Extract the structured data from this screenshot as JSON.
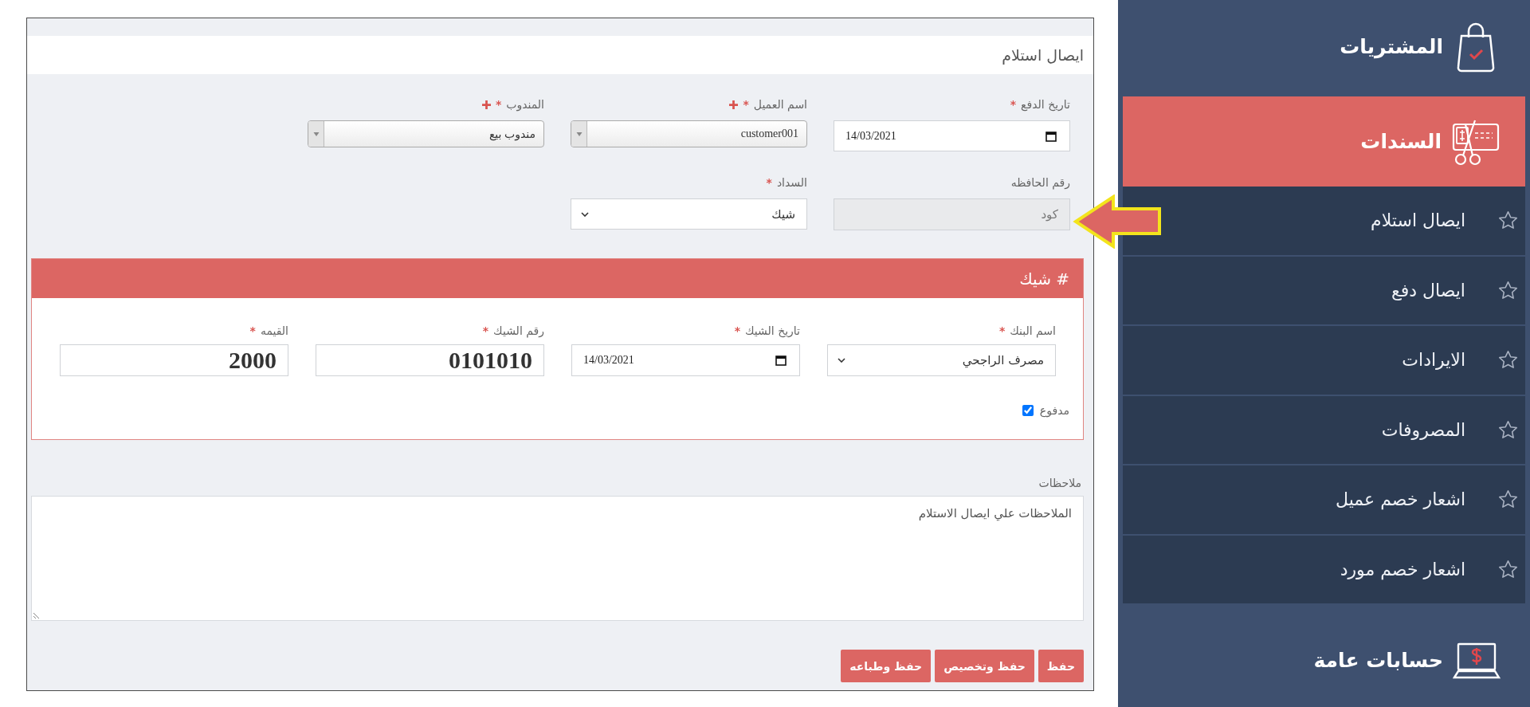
{
  "form": {
    "title": "ايصال استلام",
    "fields": [
      {
        "kind": "date",
        "label": "تاريخ الدفع",
        "mark": "*",
        "addable": false,
        "disabled": false,
        "value": "14/03/2021"
      },
      {
        "kind": "combo",
        "label": "اسم العميل",
        "mark": "*",
        "addable": true,
        "disabled": false,
        "value": "customer001"
      },
      {
        "kind": "combo",
        "label": "المندوب",
        "mark": "*",
        "addable": true,
        "disabled": false,
        "value": "مندوب بيع"
      },
      {
        "kind": "text",
        "label": "رقم الحافظه",
        "addable": false,
        "disabled": true,
        "placeholder": "كود"
      },
      {
        "kind": "select",
        "label": "السداد",
        "mark": "*",
        "addable": false,
        "disabled": false,
        "value": "شيك"
      }
    ]
  },
  "cheque": {
    "title": "# شيك",
    "fields": [
      {
        "kind": "select",
        "label": "اسم البنك",
        "mark": "*",
        "value": "مصرف الراجحي"
      },
      {
        "kind": "date",
        "label": "تاريخ الشيك",
        "mark": "*",
        "value": "14/03/2021"
      },
      {
        "kind": "number",
        "label": "رقم الشيك",
        "mark": "*",
        "value": "0101010"
      },
      {
        "kind": "number",
        "label": "القيمه",
        "mark": "*",
        "value": "2000"
      }
    ],
    "paid": {
      "label": "مدفوع",
      "checked": true
    }
  },
  "notes": {
    "label": "ملاحظات",
    "value": "الملاحظات علي ايصال الاستلام"
  },
  "buttons": [
    "حفظ",
    "حفظ وتخصيص",
    "حفظ وطباعه"
  ],
  "sidebar": {
    "sections": [
      {
        "label": "المشتريات",
        "selected": false
      },
      {
        "label": "السندات",
        "selected": true,
        "children": [
          {
            "label": "ايصال استلام",
            "selected": false
          },
          {
            "label": "ايصال دفع",
            "selected": false
          },
          {
            "label": "الايرادات",
            "selected": false
          },
          {
            "label": "المصروفات",
            "selected": false
          },
          {
            "label": "اشعار خصم عميل",
            "selected": false
          },
          {
            "label": "اشعار خصم مورد",
            "selected": false
          }
        ]
      },
      {
        "label": "حسابات عامة",
        "selected": false
      }
    ]
  }
}
